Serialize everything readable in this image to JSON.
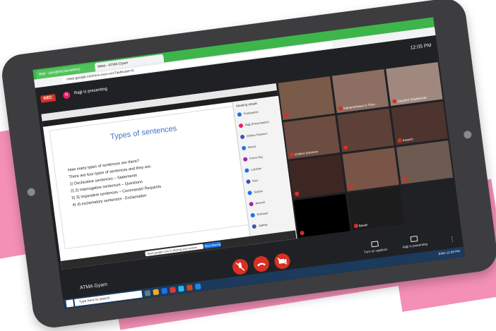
{
  "browser": {
    "tabs": [
      "Mail - jobs@drizitacademy...",
      "Meet - ATMA Gyam"
    ],
    "url": "meet.google.com/xxx-xxxx-xxx?authuser=0"
  },
  "meeting": {
    "recording_label": "REC",
    "presenter_initial": "R",
    "presenting_text": "Rajji is presenting",
    "time": "12:05 PM",
    "meeting_name": "ATMA Gyam",
    "captions_label": "Turn on captions",
    "presenting_control_label": "Rajji is presenting"
  },
  "slide": {
    "title": "Types of sentences",
    "lines": [
      "How many types of sentences are there?",
      "There are four types of sentences and they are:",
      "1)  Declarative sentences – Statements",
      "2)  2) Interrogative sentences – Questions",
      "3)  3) Imperative sentences – Commands/ Requests",
      "4)  4) exclamatory sentences - Exclamation"
    ]
  },
  "participants_panel": {
    "title": "Meeting details",
    "rows": [
      "Participants",
      "Rajji (Presentation)",
      "Chithra Solomon",
      "Meera",
      "Prince Raj",
      "Lakshmi",
      "Ravi",
      "Sophia",
      "Aneesh",
      "Krishnan",
      "Jadeep"
    ]
  },
  "participants": [
    {
      "name": "",
      "color": "#7a5a48"
    },
    {
      "name": "Mahaneshwari S Thiru..",
      "color": "#8d6e63"
    },
    {
      "name": "Gayathri Gopakumar",
      "color": "#a1887f"
    },
    {
      "name": "Chithra Solomon",
      "color": "#6d4c41"
    },
    {
      "name": "",
      "color": "#5d4037"
    },
    {
      "name": "Aneesh",
      "color": "#4e342e"
    },
    {
      "name": "",
      "color": "#3e2723"
    },
    {
      "name": "",
      "color": "#795548"
    },
    {
      "name": "",
      "color": "#6d5a50"
    },
    {
      "name": "",
      "color": "#000000"
    },
    {
      "name": "Bavan",
      "color": "#1c1c1c"
    },
    {
      "name": "",
      "color": "#202124"
    }
  ],
  "share_controls": {
    "status_text": "Meet.google.com is sharing your screen",
    "stop_label": "Stop sharing"
  },
  "taskbar": {
    "search_placeholder": "Type here to search",
    "tray_text": "ENG 12:05 PM"
  },
  "colors": {
    "accent_green": "#3db54a",
    "tablet_body": "#3d3d3f",
    "background_pink": "#f48fb6",
    "slide_title_blue": "#4472c4",
    "meet_red": "#d93025"
  }
}
